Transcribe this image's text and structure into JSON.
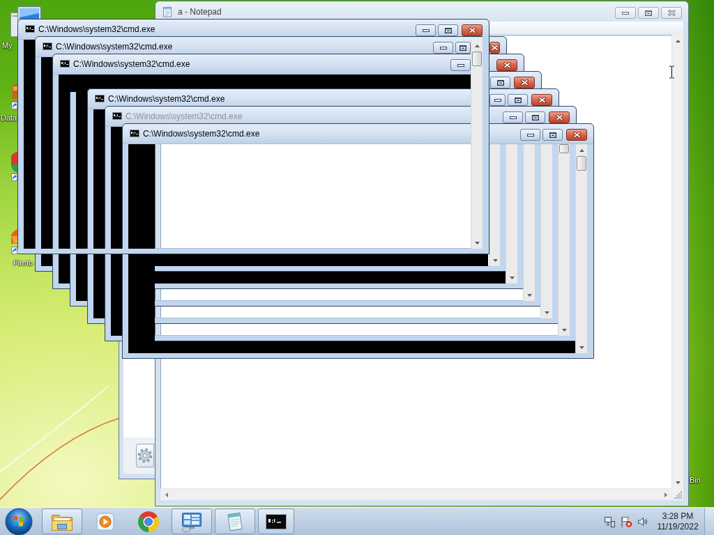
{
  "desktop": {
    "icons": [
      {
        "kind": "computer",
        "label": "My"
      },
      {
        "kind": "data-shortcut",
        "label": "Data"
      },
      {
        "kind": "chrome-shortcut"
      },
      {
        "kind": "firefox-shortcut",
        "label": "Firefo"
      },
      {
        "kind": "recycle-bin",
        "label": "Bin"
      }
    ]
  },
  "notepad": {
    "title": "a - Notepad"
  },
  "console_windows": [
    {
      "kind": "normal",
      "title": "C:\\Windows\\system32\\cmd.exe",
      "dimmed": false
    },
    {
      "kind": "normal",
      "title": "C:\\Windows\\system32\\cmd.exe",
      "dimmed": false
    },
    {
      "kind": "normal",
      "title": "C:\\Windows\\system32\\cmd.exe",
      "dimmed": false
    },
    {
      "kind": "ghost"
    },
    {
      "kind": "normal",
      "title": "C:\\Windows\\system32\\cmd.exe",
      "dimmed": false
    },
    {
      "kind": "normal",
      "title": "C:\\Windows\\system32\\cmd.exe",
      "dimmed": true
    },
    {
      "kind": "normal",
      "title": "C:\\Windows\\system32\\cmd.exe",
      "dimmed": false
    }
  ],
  "taskbar": {
    "items": [
      {
        "kind": "explorer",
        "running": true
      },
      {
        "kind": "media-player",
        "running": false
      },
      {
        "kind": "chrome",
        "running": false
      },
      {
        "kind": "remote-desktop",
        "running": true
      },
      {
        "kind": "notepad",
        "running": true
      },
      {
        "kind": "console",
        "running": true
      }
    ],
    "clock": {
      "time": "3:28 PM",
      "date": "11/19/2022"
    }
  }
}
